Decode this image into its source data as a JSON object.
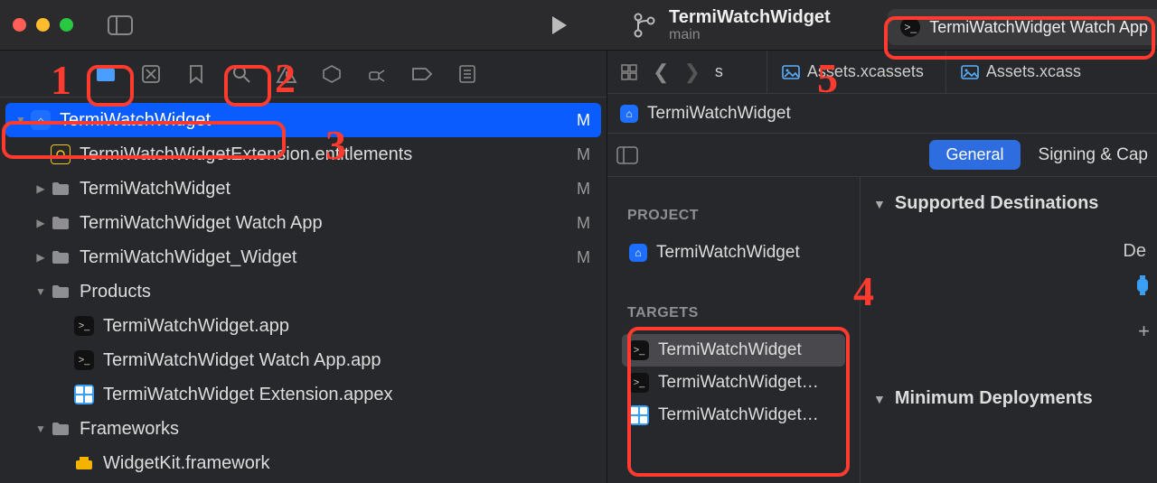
{
  "titlebar": {
    "project_name": "TermiWatchWidget",
    "branch": "main",
    "scheme": "TermiWatchWidget Watch App"
  },
  "navigator": {
    "root": {
      "name": "TermiWatchWidget",
      "status": "M"
    },
    "items": [
      {
        "name": "TermiWatchWidgetExtension.entitlements",
        "status": "M",
        "depth": 1,
        "icon": "entitlements",
        "disc": ""
      },
      {
        "name": "TermiWatchWidget",
        "status": "M",
        "depth": 1,
        "icon": "folder",
        "disc": "right"
      },
      {
        "name": "TermiWatchWidget Watch App",
        "status": "M",
        "depth": 1,
        "icon": "folder",
        "disc": "right"
      },
      {
        "name": "TermiWatchWidget_Widget",
        "status": "M",
        "depth": 1,
        "icon": "folder",
        "disc": "right"
      },
      {
        "name": "Products",
        "status": "",
        "depth": 1,
        "icon": "folder",
        "disc": "down"
      },
      {
        "name": "TermiWatchWidget.app",
        "status": "",
        "depth": 2,
        "icon": "app",
        "disc": ""
      },
      {
        "name": "TermiWatchWidget Watch App.app",
        "status": "",
        "depth": 2,
        "icon": "app",
        "disc": ""
      },
      {
        "name": "TermiWatchWidget Extension.appex",
        "status": "",
        "depth": 2,
        "icon": "appex",
        "disc": ""
      },
      {
        "name": "Frameworks",
        "status": "",
        "depth": 1,
        "icon": "folder",
        "disc": "down"
      },
      {
        "name": "WidgetKit.framework",
        "status": "",
        "depth": 2,
        "icon": "framework",
        "disc": ""
      }
    ]
  },
  "tabs": {
    "path_fragment": "s",
    "tab1": "Assets.xcassets",
    "tab2": "Assets.xcass"
  },
  "breadcrumb": {
    "item": "TermiWatchWidget"
  },
  "editor": {
    "segment_general": "General",
    "segment_signing": "Signing & Cap"
  },
  "project_sidebar": {
    "project_header": "PROJECT",
    "project_name": "TermiWatchWidget",
    "targets_header": "TARGETS",
    "targets": [
      {
        "name": "TermiWatchWidget",
        "icon": "app"
      },
      {
        "name": "TermiWatchWidget…",
        "icon": "app"
      },
      {
        "name": "TermiWatchWidget…",
        "icon": "appex"
      }
    ]
  },
  "detail": {
    "section1": "Supported Destinations",
    "col_label": "De",
    "section2": "Minimum Deployments",
    "plus": "+"
  },
  "annotations": {
    "n1": "1",
    "n2": "2",
    "n3": "3",
    "n4": "4",
    "n5": "5"
  }
}
